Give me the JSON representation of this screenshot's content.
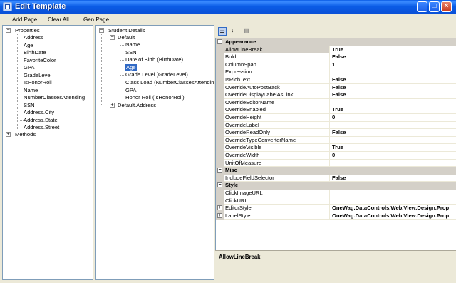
{
  "window": {
    "title": "Edit Template"
  },
  "toolbar": {
    "add_page": "Add Page",
    "clear_all": "Clear All",
    "gen_page": "Gen Page"
  },
  "left_tree": {
    "root_label": "Properties",
    "items": [
      "Address",
      "Age",
      "BirthDate",
      "FavoriteColor",
      "GPA",
      "GradeLevel",
      "IsHonorRoll",
      "Name",
      "NumberClassesAttending",
      "SSN",
      "Address.City",
      "Address.State",
      "Address.Street"
    ],
    "methods_label": "Methods"
  },
  "mid_tree": {
    "root_label": "Student Details",
    "default_label": "Default",
    "items": [
      "Name",
      "SSN",
      "Date of Birth (BirthDate)",
      "Age",
      "Grade Level (GradeLevel)",
      "Class Load (NumberClassesAttending)",
      "GPA",
      "Honor Roll (IsHonorRoll)"
    ],
    "selected_item": "Age",
    "default_address_label": "Default.Address"
  },
  "grid": {
    "categories": {
      "appearance": "Appearance",
      "misc": "Misc",
      "style": "Style"
    },
    "appearance_rows": [
      {
        "name": "AllowLineBreak",
        "value": "True"
      },
      {
        "name": "Bold",
        "value": "False"
      },
      {
        "name": "ColumnSpan",
        "value": "1"
      },
      {
        "name": "Expression",
        "value": ""
      },
      {
        "name": "IsRichText",
        "value": "False"
      },
      {
        "name": "OverrideAutoPostBack",
        "value": "False"
      },
      {
        "name": "OverrideDisplayLabelAsLink",
        "value": "False"
      },
      {
        "name": "OverrideEditorName",
        "value": ""
      },
      {
        "name": "OverrideEnabled",
        "value": "True"
      },
      {
        "name": "OverrideHeight",
        "value": "0"
      },
      {
        "name": "OverrideLabel",
        "value": ""
      },
      {
        "name": "OverrideReadOnly",
        "value": "False"
      },
      {
        "name": "OverrideTypeConverterName",
        "value": ""
      },
      {
        "name": "OverrideVisible",
        "value": "True"
      },
      {
        "name": "OverrideWidth",
        "value": "0"
      },
      {
        "name": "UnitOfMeasure",
        "value": ""
      }
    ],
    "misc_rows": [
      {
        "name": "IncludeFieldSelector",
        "value": "False"
      }
    ],
    "style_rows": [
      {
        "name": "ClickImageURL",
        "value": "",
        "expandable": false
      },
      {
        "name": "ClickURL",
        "value": "",
        "expandable": false
      },
      {
        "name": "EditorStyle",
        "value": "OneWag.DataControls.Web.View.Design.Prop",
        "expandable": true
      },
      {
        "name": "LabelStyle",
        "value": "OneWag.DataControls.Web.View.Design.Prop",
        "expandable": true
      }
    ],
    "description_title": "AllowLineBreak"
  },
  "colors": {
    "titlebar": "#0a5ce6",
    "selection": "#316ac5",
    "chrome": "#ece9d8"
  }
}
